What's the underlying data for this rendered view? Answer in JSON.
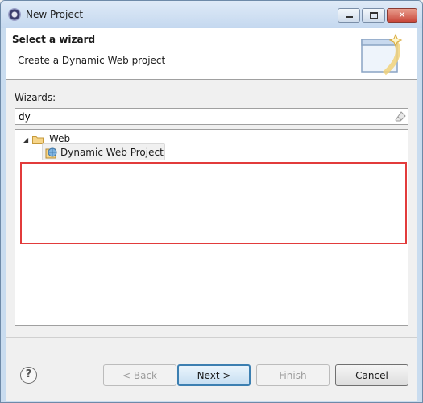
{
  "window": {
    "title": "New Project"
  },
  "banner": {
    "title": "Select a wizard",
    "description": "Create a Dynamic Web project",
    "graphic_icon": "new-wizard-banner-graphic"
  },
  "wizards": {
    "label": "Wizards:",
    "filter_value": "dy",
    "clear_icon": "eraser-icon"
  },
  "tree": {
    "category": {
      "label": "Web",
      "expanded": true,
      "icon": "folder-icon"
    },
    "items": [
      {
        "label": "Dynamic Web Project",
        "icon": "dynamic-web-project-icon",
        "selected": true
      }
    ]
  },
  "buttons": {
    "help": "?",
    "back": "< Back",
    "next": "Next >",
    "finish": "Finish",
    "cancel": "Cancel"
  },
  "colors": {
    "highlight": "#e23b3b",
    "default_button_border": "#3c7fb1"
  }
}
